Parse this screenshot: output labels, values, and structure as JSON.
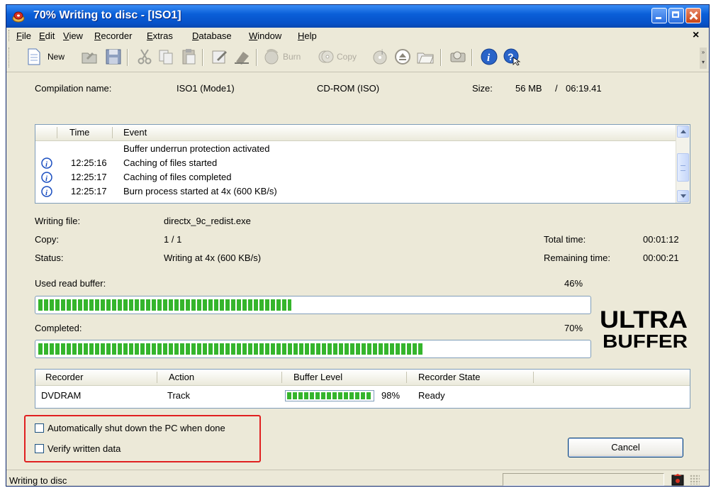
{
  "window": {
    "title": "70% Writing to disc - [ISO1]"
  },
  "menu": {
    "items": [
      "File",
      "Edit",
      "View",
      "Recorder",
      "Extras",
      "Database",
      "Window",
      "Help"
    ],
    "close": "×"
  },
  "toolbar": {
    "new_label": "New",
    "burn_label": "Burn",
    "copy_label": "Copy"
  },
  "compilation": {
    "name_label": "Compilation name:",
    "name": "ISO1 (Mode1)",
    "type": "CD-ROM (ISO)",
    "size_label": "Size:",
    "size": "56 MB",
    "size_sep": "/",
    "duration": "06:19.41"
  },
  "log": {
    "headers": {
      "time": "Time",
      "event": "Event"
    },
    "rows": [
      {
        "icon": "",
        "time": "",
        "event": "Buffer underrun protection activated"
      },
      {
        "icon": "info-icon",
        "time": "12:25:16",
        "event": "Caching of files started"
      },
      {
        "icon": "info-icon",
        "time": "12:25:17",
        "event": "Caching of files completed"
      },
      {
        "icon": "info-icon",
        "time": "12:25:17",
        "event": "Burn process started at 4x (600 KB/s)"
      }
    ]
  },
  "details": {
    "writing_file_label": "Writing file:",
    "writing_file": "directx_9c_redist.exe",
    "copy_label": "Copy:",
    "copy": "1 / 1",
    "status_label": "Status:",
    "status": "Writing at 4x (600 KB/s)",
    "total_time_label": "Total time:",
    "total_time": "00:01:12",
    "remaining_time_label": "Remaining time:",
    "remaining_time": "00:00:21"
  },
  "buffer": {
    "label": "Used read buffer:",
    "percent_text": "46%",
    "fraction": 0.46
  },
  "completed": {
    "label": "Completed:",
    "percent_text": "70%",
    "fraction": 0.7
  },
  "logo": {
    "line1": "ULTRA",
    "line2": "BUFFER"
  },
  "recorders": {
    "headers": {
      "recorder": "Recorder",
      "action": "Action",
      "buffer_level": "Buffer Level",
      "state": "Recorder State"
    },
    "rows": [
      {
        "recorder": "DVDRAM",
        "action": "Track",
        "buffer_text": "98%",
        "buffer_fraction": 0.98,
        "state": "Ready"
      }
    ]
  },
  "options": {
    "shutdown_label": "Automatically shut down the PC when done",
    "verify_label": "Verify written data"
  },
  "buttons": {
    "cancel": "Cancel"
  },
  "statusbar": {
    "text": "Writing to disc"
  }
}
